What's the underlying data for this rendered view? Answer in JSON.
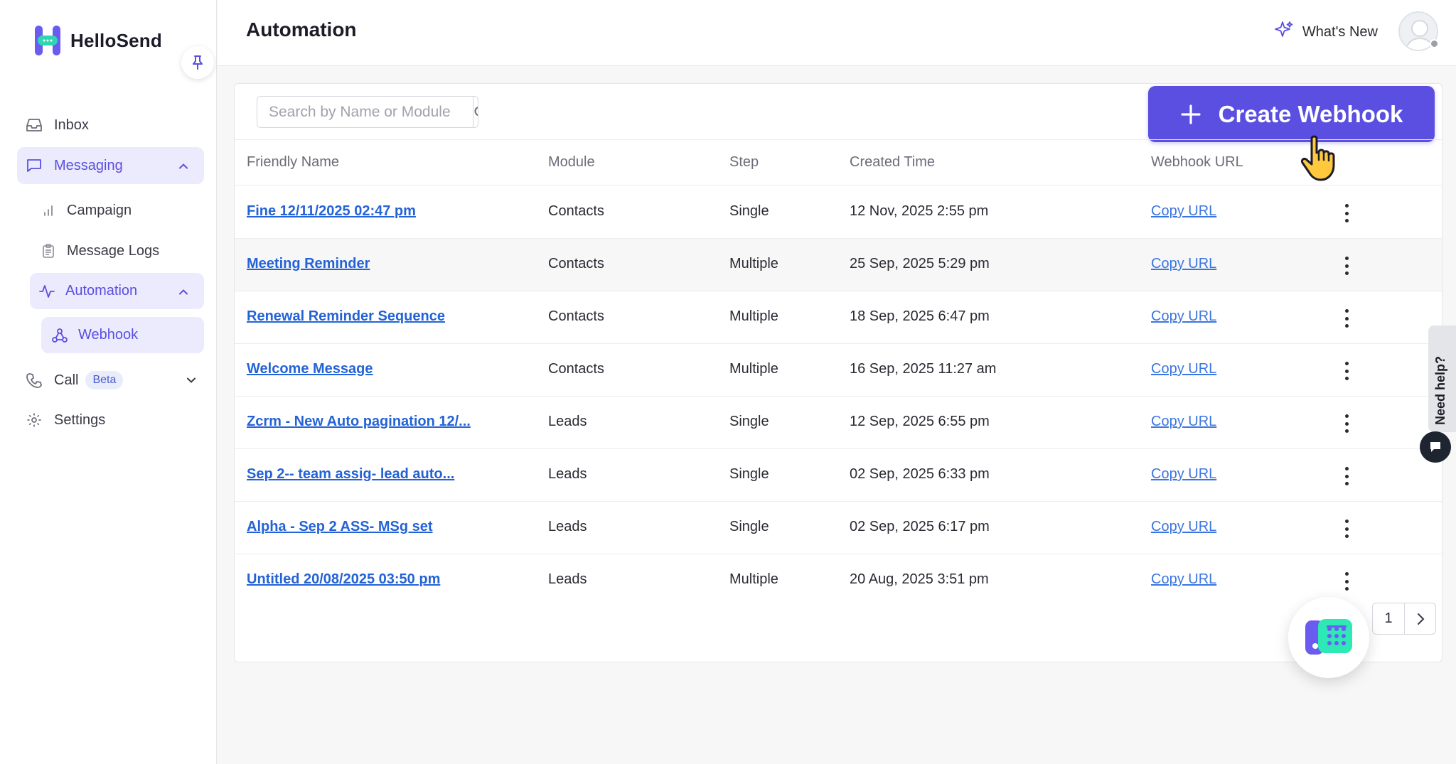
{
  "app": {
    "name": "HelloSend"
  },
  "sidebar": {
    "items": [
      {
        "label": "Inbox",
        "icon": "inbox-icon"
      },
      {
        "label": "Messaging",
        "icon": "message-square-icon",
        "expanded": true
      },
      {
        "label": "Campaign",
        "icon": "bar-chart-icon"
      },
      {
        "label": "Message Logs",
        "icon": "clipboard-icon"
      },
      {
        "label": "Automation",
        "icon": "activity-icon",
        "expanded": true
      },
      {
        "label": "Webhook",
        "icon": "webhook-icon",
        "active": true
      },
      {
        "label": "Call",
        "icon": "phone-icon",
        "badge": "Beta"
      },
      {
        "label": "Settings",
        "icon": "gear-icon"
      }
    ]
  },
  "header": {
    "title": "Automation",
    "whats_new": "What's New"
  },
  "toolbar": {
    "search_placeholder": "Search by Name or Module",
    "create_label": "Create Webhook"
  },
  "table": {
    "columns": [
      "Friendly Name",
      "Module",
      "Step",
      "Created Time",
      "Webhook URL"
    ],
    "rows": [
      {
        "name": "Fine 12/11/2025 02:47 pm",
        "module": "Contacts",
        "step": "Single",
        "created": "12 Nov, 2025 2:55 pm",
        "url": "Copy URL"
      },
      {
        "name": "Meeting Reminder",
        "module": "Contacts",
        "step": "Multiple",
        "created": "25 Sep, 2025 5:29 pm",
        "url": "Copy URL"
      },
      {
        "name": "Renewal Reminder Sequence",
        "module": "Contacts",
        "step": "Multiple",
        "created": "18 Sep, 2025 6:47 pm",
        "url": "Copy URL"
      },
      {
        "name": "Welcome Message",
        "module": "Contacts",
        "step": "Multiple",
        "created": "16 Sep, 2025 11:27 am",
        "url": "Copy URL"
      },
      {
        "name": "Zcrm - New Auto pagination 12/...",
        "module": "Leads",
        "step": "Single",
        "created": "12 Sep, 2025 6:55 pm",
        "url": "Copy URL"
      },
      {
        "name": "Sep 2-- team assig- lead auto...",
        "module": "Leads",
        "step": "Single",
        "created": "02 Sep, 2025 6:33 pm",
        "url": "Copy URL"
      },
      {
        "name": "Alpha - Sep 2 ASS- MSg set",
        "module": "Leads",
        "step": "Single",
        "created": "02 Sep, 2025 6:17 pm",
        "url": "Copy URL"
      },
      {
        "name": "Untitled 20/08/2025 03:50 pm",
        "module": "Leads",
        "step": "Multiple",
        "created": "20 Aug, 2025 3:51 pm",
        "url": "Copy URL"
      }
    ]
  },
  "pagination": {
    "current": "1"
  },
  "help": {
    "label": "Need help?"
  },
  "colors": {
    "accent": "#5a4fe0",
    "accent_light": "#ecebfd",
    "link": "#2463d6"
  }
}
